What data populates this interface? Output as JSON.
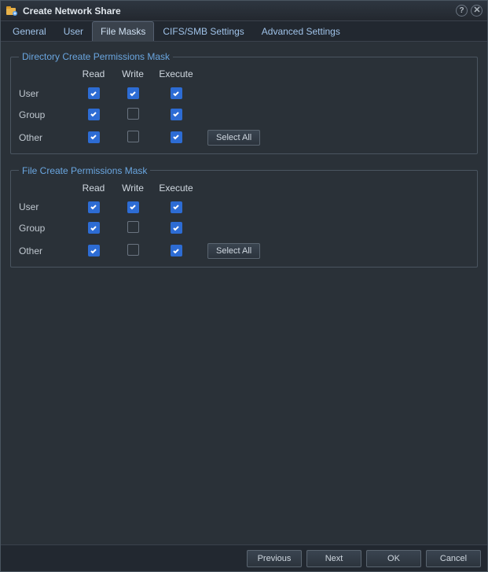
{
  "window": {
    "title": "Create Network Share"
  },
  "tabs": {
    "general": "General",
    "user": "User",
    "file_masks": "File Masks",
    "cifs": "CIFS/SMB Settings",
    "advanced": "Advanced Settings",
    "active": "file_masks"
  },
  "columns": {
    "read": "Read",
    "write": "Write",
    "execute": "Execute"
  },
  "rows": {
    "user": "User",
    "group": "Group",
    "other": "Other"
  },
  "dir_group": {
    "legend": "Directory Create Permissions Mask",
    "select_all": "Select All",
    "perm": {
      "user": {
        "read": true,
        "write": true,
        "execute": true
      },
      "group": {
        "read": true,
        "write": false,
        "execute": true
      },
      "other": {
        "read": true,
        "write": false,
        "execute": true
      }
    }
  },
  "file_group": {
    "legend": "File Create Permissions Mask",
    "select_all": "Select All",
    "perm": {
      "user": {
        "read": true,
        "write": true,
        "execute": true
      },
      "group": {
        "read": true,
        "write": false,
        "execute": true
      },
      "other": {
        "read": true,
        "write": false,
        "execute": true
      }
    }
  },
  "footer": {
    "previous": "Previous",
    "next": "Next",
    "ok": "OK",
    "cancel": "Cancel"
  }
}
